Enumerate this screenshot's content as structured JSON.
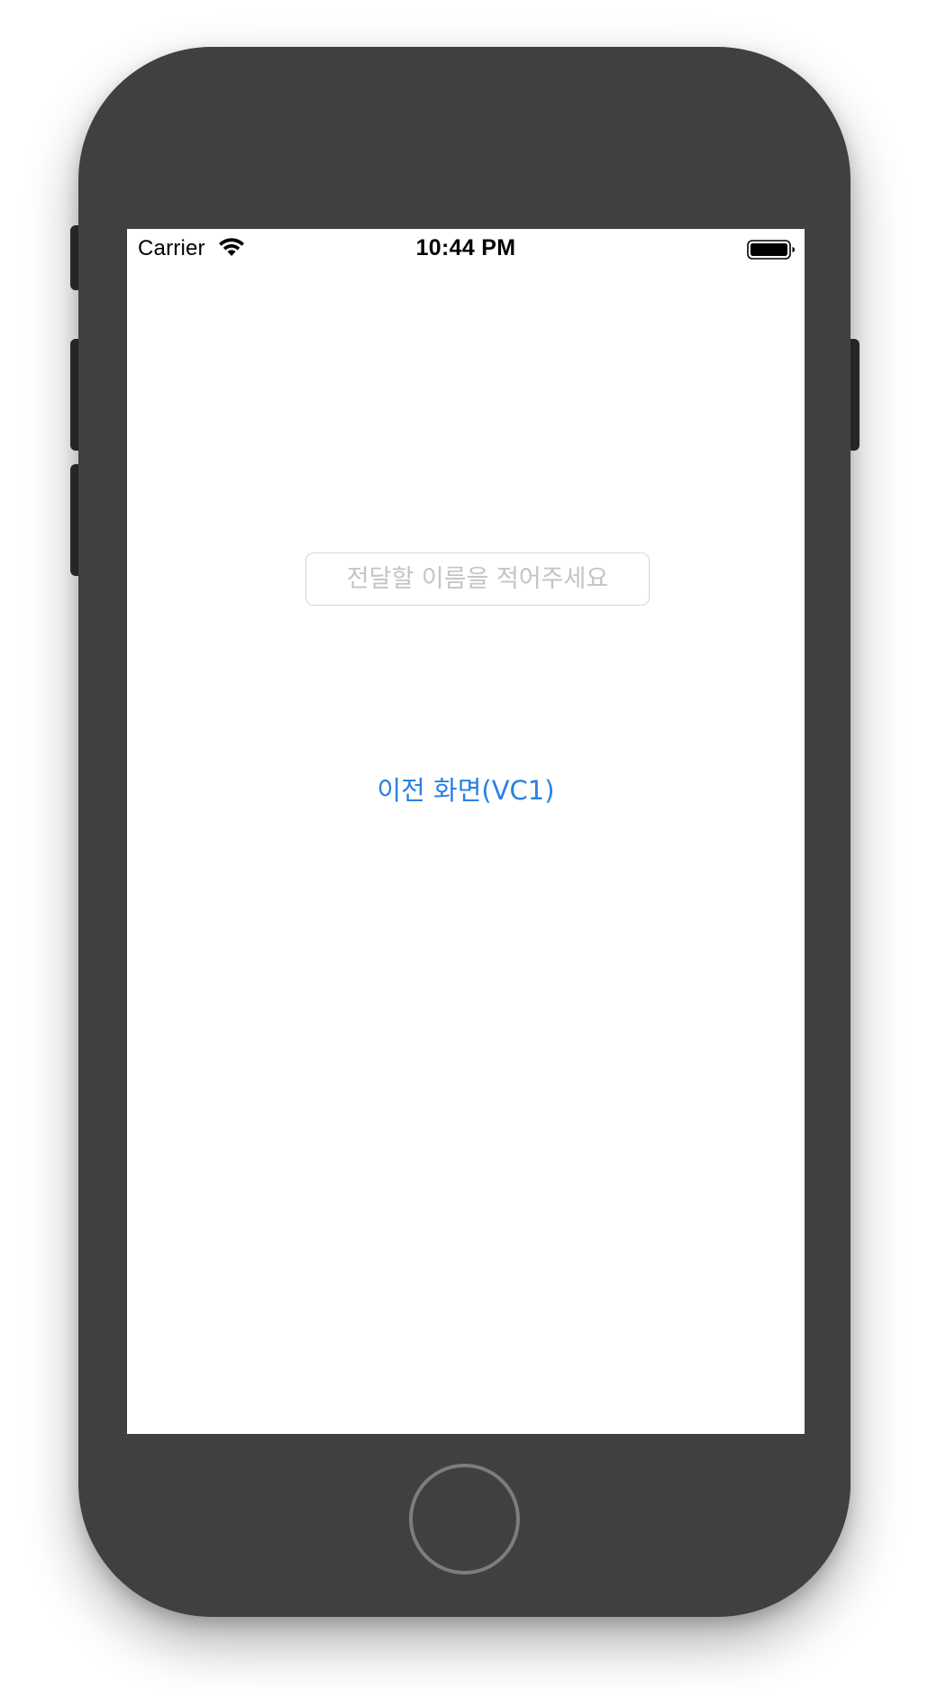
{
  "status_bar": {
    "carrier": "Carrier",
    "time": "10:44 PM",
    "wifi_icon": "wifi-icon",
    "battery_icon": "battery-full-icon"
  },
  "form": {
    "name_field": {
      "placeholder": "전달할 이름을 적어주세요",
      "value": ""
    },
    "back_button_label": "이전 화면(VC1)"
  },
  "colors": {
    "device_body": "#404040",
    "screen_background": "#ffffff",
    "accent": "#2a7fe4",
    "placeholder": "#c4c4c8",
    "field_border": "#d6d6d6"
  },
  "device": {
    "home_button_icon": "home-button-ring-icon"
  }
}
